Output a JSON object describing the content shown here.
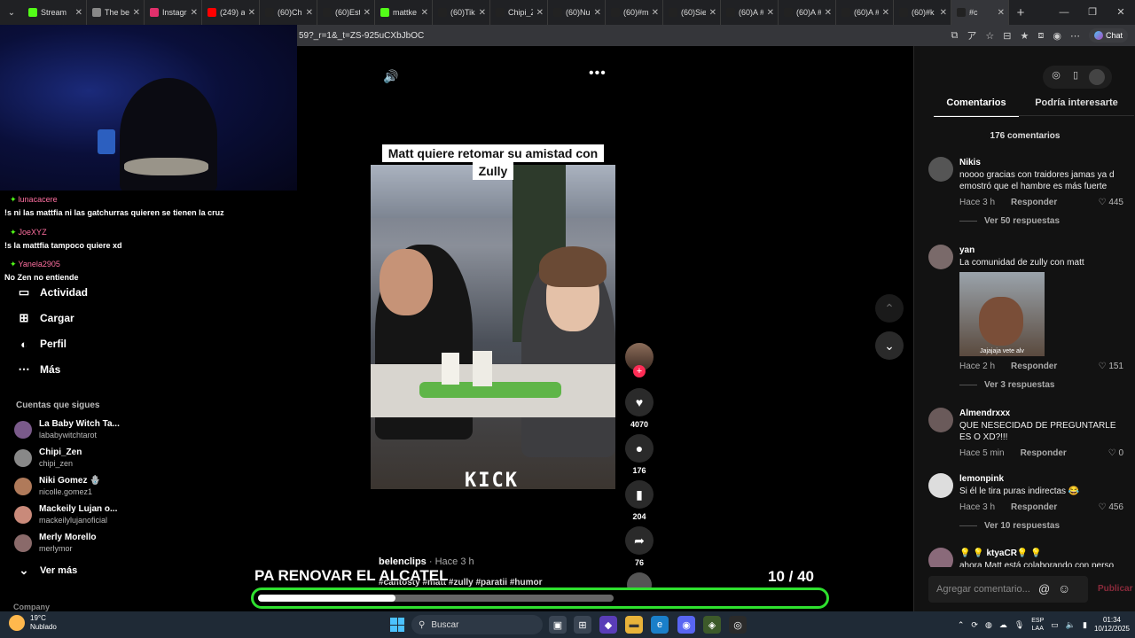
{
  "browser": {
    "tabs": [
      {
        "label": "Stream",
        "color": "#53fc18"
      },
      {
        "label": "The be",
        "color": "#888888"
      },
      {
        "label": "Instagra",
        "color": "#e1306c"
      },
      {
        "label": "(249) a",
        "color": "#ff0000"
      },
      {
        "label": "(60)Chi",
        "color": "#222222"
      },
      {
        "label": "(60)Est",
        "color": "#222222"
      },
      {
        "label": "mattke",
        "color": "#53fc18"
      },
      {
        "label": "(60)Tik",
        "color": "#222222"
      },
      {
        "label": "Chipi_Z",
        "color": "#222222"
      },
      {
        "label": "(60)Nu",
        "color": "#222222"
      },
      {
        "label": "(60)#m",
        "color": "#222222"
      },
      {
        "label": "(60)Sie",
        "color": "#222222"
      },
      {
        "label": "(60)A #",
        "color": "#222222"
      },
      {
        "label": "(60)A #",
        "color": "#222222"
      },
      {
        "label": "(60)A #",
        "color": "#222222"
      },
      {
        "label": "(60)#k",
        "color": "#222222"
      },
      {
        "label": "#c",
        "color": "#222222"
      }
    ],
    "url": "59?_r=1&_t=ZS-925uCXbJbOC",
    "chat_label": "Chat"
  },
  "stream_chat": [
    {
      "name": "lunacacere",
      "message": "!s ni las mattfia ni las gatchurras quieren se tienen la cruz"
    },
    {
      "name": "JoeXYZ",
      "message": "!s la mattfia tampoco quiere xd"
    },
    {
      "name": "Yanela2905",
      "message": "No Zen no entiende"
    }
  ],
  "sidebar": {
    "items": [
      {
        "label": "Actividad",
        "icon": "inbox-icon"
      },
      {
        "label": "Cargar",
        "icon": "upload-icon"
      },
      {
        "label": "Perfil",
        "icon": "profile-icon"
      },
      {
        "label": "Más",
        "icon": "more-icon"
      }
    ],
    "following_title": "Cuentas que sigues",
    "following": [
      {
        "name": "La Baby Witch Ta...",
        "handle": "lababywitchtarot",
        "color": "#7a5a8a"
      },
      {
        "name": "Chipi_Zen",
        "handle": "chipi_zen",
        "color": "#888888"
      },
      {
        "name": "Niki Gomez 🪬",
        "handle": "nicolle.gomez1",
        "color": "#b07a5a"
      },
      {
        "name": "Mackeily Lujan o...",
        "handle": "mackeilylujanoficial",
        "color": "#c98a7a"
      },
      {
        "name": "Merly Morello",
        "handle": "merlymor",
        "color": "#8a6a6a"
      }
    ],
    "see_more": "Ver más",
    "company": "Company"
  },
  "video": {
    "caption": "Matt quiere retomar su amistad con Zully",
    "watermark": "KICK",
    "author": "belenclips",
    "time": "· Hace 3 h",
    "hashtags": "#cantosty #matt #zully #paratii #humor",
    "likes": "4070",
    "comments": "176",
    "saves": "204",
    "shares": "76"
  },
  "overlay": {
    "title": "PA RENOVAR EL ALCATEL",
    "current": "10",
    "total": "/ 40",
    "progress": 0.25
  },
  "panel": {
    "tab_comments": "Comentarios",
    "tab_interest": "Podría interesarte",
    "count": "176 comentarios",
    "comments": [
      {
        "user": "Nikis",
        "text": "noooo gracias con traidores jamas ya d emostró que el hambre es más fuerte",
        "time": "Hace 3 h",
        "reply": "Responder",
        "likes": "445",
        "replies": "Ver 50 respuestas",
        "avatar_color": "#555555"
      },
      {
        "user": "yan",
        "text": "La comunidad de zully con matt",
        "image_caption": "Jajajaja vete alv",
        "time": "Hace 2 h",
        "reply": "Responder",
        "likes": "151",
        "replies": "Ver 3 respuestas",
        "avatar_color": "#7a6a6a"
      },
      {
        "user": "Almendrxxx",
        "text": "QUE NESECIDAD DE PREGUNTARLE ES O XD?!!!",
        "time": "Hace 5 min",
        "reply": "Responder",
        "likes": "0",
        "avatar_color": "#6a5a5a"
      },
      {
        "user": "lemonpink",
        "text": "Si él le tira puras indirectas 😂",
        "time": "Hace 3 h",
        "reply": "Responder",
        "likes": "456",
        "replies": "Ver 10 respuestas",
        "avatar_color": "#dddddd"
      },
      {
        "user": "💡 💡 ktyaCR💡 💡",
        "text": "ahora Matt está colaborando con perso",
        "avatar_color": "#8a6a7a"
      }
    ],
    "input_placeholder": "Agregar comentario...",
    "publish": "Publicar"
  },
  "taskbar": {
    "temp": "19°C",
    "weather": "Nublado",
    "search": "Buscar",
    "lang1": "ESP",
    "lang2": "LAA",
    "time": "01:34",
    "date": "10/12/2025"
  }
}
